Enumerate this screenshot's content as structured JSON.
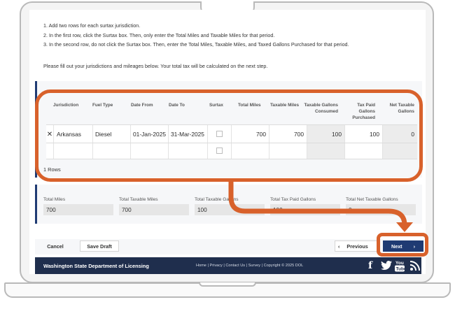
{
  "instructions": [
    "1. Add two rows for each surtax jurisdiction.",
    "2. In the first row, click the Surtax box. Then, only enter the Total Miles and Taxable Miles for that period.",
    "3. In the second row, do not click the Surtax box. Then, enter the Total Miles, Taxable Miles, and Taxed Gallons Purchased for that period."
  ],
  "intro": "Please fill out your jurisdictions and mileages below. Your total tax will be calculated on the next step.",
  "table": {
    "headers": {
      "jurisdiction": "Jurisdiction",
      "fuel_type": "Fuel Type",
      "date_from": "Date From",
      "date_to": "Date To",
      "surtax": "Surtax",
      "total_miles": "Total Miles",
      "taxable_miles": "Taxable Miles",
      "taxable_gallons": "Taxable Gallons Consumed",
      "tax_paid_gallons": "Tax Paid Gallons Purchased",
      "net_taxable_gallons": "Net Taxable Gallons"
    },
    "rows": [
      {
        "remove_icon": "close-icon",
        "jurisdiction": "Arkansas",
        "fuel_type": "Diesel",
        "date_from": "01-Jan-2025",
        "date_to": "31-Mar-2025",
        "surtax": false,
        "total_miles": "700",
        "taxable_miles": "700",
        "taxable_gallons": "100",
        "tax_paid_gallons": "100",
        "net_taxable_gallons": "0"
      },
      {
        "jurisdiction": "",
        "fuel_type": "",
        "date_from": "",
        "date_to": "",
        "surtax": false,
        "total_miles": "",
        "taxable_miles": "",
        "taxable_gallons": "",
        "tax_paid_gallons": "",
        "net_taxable_gallons": ""
      }
    ],
    "row_count": "1 Rows"
  },
  "totals": {
    "total_miles_label": "Total Miles",
    "total_miles": "700",
    "total_taxable_miles_label": "Total Taxable Miles",
    "total_taxable_miles": "700",
    "total_taxable_gallons_label": "Total Taxable Gallons",
    "total_taxable_gallons": "100",
    "total_tax_paid_label": "Total Tax Paid Gallons",
    "total_tax_paid": "100",
    "total_net_label": "Total Net Taxable Gallons",
    "total_net": "0"
  },
  "buttons": {
    "cancel": "Cancel",
    "save_draft": "Save Draft",
    "previous": "Previous",
    "next": "Next"
  },
  "footer": {
    "brand": "Washington State Department of Licensing",
    "links": "Home | Privacy | Contact Us | Survey | Copyright © 2025 DOL",
    "social": [
      "facebook-icon",
      "twitter-icon",
      "youtube-icon",
      "rss-icon"
    ]
  },
  "colors": {
    "accent": "#1f3b73",
    "highlight": "#d8612b",
    "footer": "#1f2e4d"
  }
}
